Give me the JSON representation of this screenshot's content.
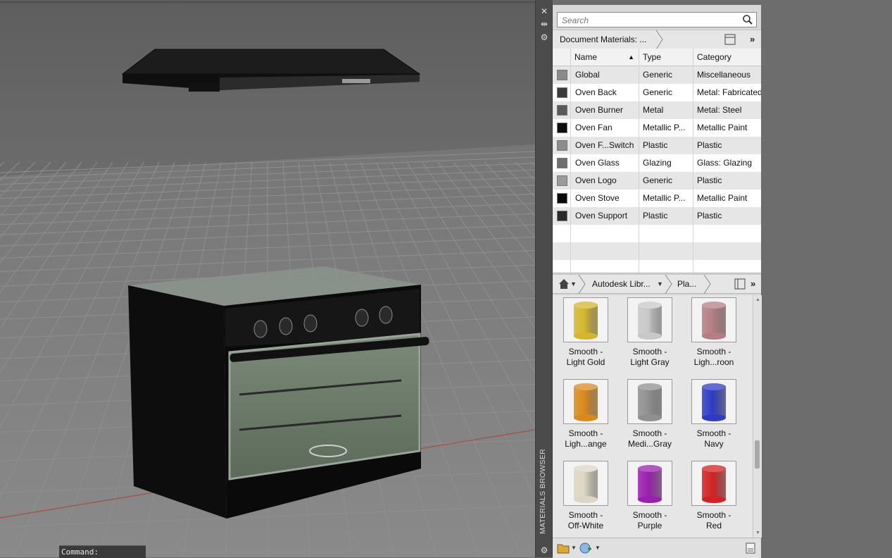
{
  "command_prompt": "Command:",
  "browser": {
    "vertical_title": "MATERIALS BROWSER",
    "search_placeholder": "Search",
    "document_crumb": "Document Materials: ...",
    "columns": {
      "name": "Name",
      "type": "Type",
      "category": "Category"
    },
    "materials": [
      {
        "name": "Global",
        "type": "Generic",
        "category": "Miscellaneous",
        "swatch": "#8a8a8a"
      },
      {
        "name": "Oven Back",
        "type": "Generic",
        "category": "Metal: Fabricated",
        "swatch": "#3a3a3a"
      },
      {
        "name": "Oven Burner",
        "type": "Metal",
        "category": "Metal: Steel",
        "swatch": "#5a5a5a"
      },
      {
        "name": "Oven Fan",
        "type": "Metallic P...",
        "category": "Metallic Paint",
        "swatch": "#0e0e0e"
      },
      {
        "name": "Oven F...Switch",
        "type": "Plastic",
        "category": "Plastic",
        "swatch": "#8c8c8c"
      },
      {
        "name": "Oven Glass",
        "type": "Glazing",
        "category": "Glass: Glazing",
        "swatch": "#6e6e6e"
      },
      {
        "name": "Oven Logo",
        "type": "Generic",
        "category": "Plastic",
        "swatch": "#9a9a9a"
      },
      {
        "name": "Oven Stove",
        "type": "Metallic P...",
        "category": "Metallic Paint",
        "swatch": "#0a0a0a"
      },
      {
        "name": "Oven Support",
        "type": "Plastic",
        "category": "Plastic",
        "swatch": "#2a2a2a"
      }
    ],
    "library_crumb": "Autodesk Libr...",
    "library_sub_crumb": "Pla...",
    "library": [
      {
        "line1": "Smooth -",
        "line2": "Light Gold",
        "color": "#d4b62e"
      },
      {
        "line1": "Smooth -",
        "line2": "Light Gray",
        "color": "#c8c8c8"
      },
      {
        "line1": "Smooth -",
        "line2": "Ligh...roon",
        "color": "#b47f84"
      },
      {
        "line1": "Smooth -",
        "line2": "Ligh...ange",
        "color": "#d98a1c"
      },
      {
        "line1": "Smooth -",
        "line2": "Medi...Gray",
        "color": "#909090"
      },
      {
        "line1": "Smooth -",
        "line2": "Navy",
        "color": "#2f3bc4"
      },
      {
        "line1": "Smooth -",
        "line2": "Off-White",
        "color": "#ddd6c4"
      },
      {
        "line1": "Smooth -",
        "line2": "Purple",
        "color": "#9a1fae"
      },
      {
        "line1": "Smooth -",
        "line2": "Red",
        "color": "#d22222"
      }
    ]
  }
}
